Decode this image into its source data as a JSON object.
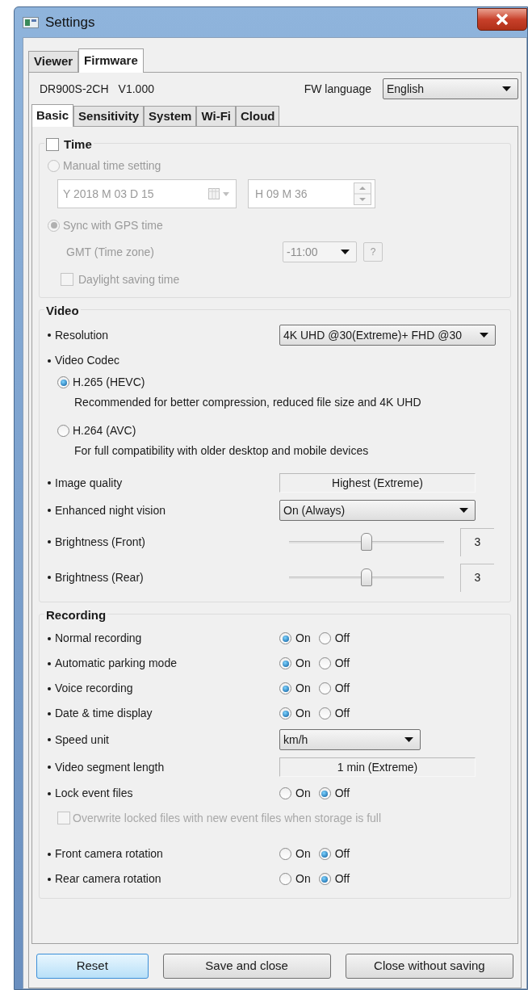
{
  "window": {
    "title": "Settings"
  },
  "top_tabs": [
    {
      "label": "Viewer",
      "selected": false
    },
    {
      "label": "Firmware",
      "selected": true
    }
  ],
  "firmware": {
    "model": "DR900S-2CH",
    "version": "V1.000",
    "language_label": "FW language",
    "language": "English"
  },
  "sub_tabs": [
    {
      "label": "Basic",
      "selected": true
    },
    {
      "label": "Sensitivity",
      "selected": false
    },
    {
      "label": "System",
      "selected": false
    },
    {
      "label": "Wi-Fi",
      "selected": false
    },
    {
      "label": "Cloud",
      "selected": false
    }
  ],
  "time": {
    "title": "Time",
    "checked": false,
    "manual": {
      "label": "Manual time setting",
      "selected": false
    },
    "date": "Y 2018 M 03 D 15",
    "clock": "H 09 M 36",
    "gps": {
      "label": "Sync with GPS time",
      "selected": true
    },
    "timezone_label": "GMT (Time zone)",
    "timezone": "-11:00",
    "help": "?",
    "dst": {
      "label": "Daylight saving time",
      "checked": false
    }
  },
  "video": {
    "title": "Video",
    "rows": [
      {
        "kind": "select",
        "label": "Resolution",
        "value": "4K UHD @30(Extreme)+ FHD @30",
        "wide": true
      },
      {
        "kind": "codec",
        "label": "Video Codec",
        "options": [
          {
            "label": "H.265 (HEVC)",
            "description": "Recommended for better compression, reduced file size and 4K UHD",
            "selected": true
          },
          {
            "label": "H.264 (AVC)",
            "description": "For full compatibility with older desktop and mobile devices",
            "selected": false
          }
        ]
      },
      {
        "kind": "display",
        "label": "Image quality",
        "value": "Highest (Extreme)"
      },
      {
        "kind": "select",
        "label": "Enhanced night vision",
        "value": "On (Always)",
        "wide": false
      },
      {
        "kind": "slider",
        "label": "Brightness (Front)",
        "level": 0.5,
        "reading": "3"
      },
      {
        "kind": "slider",
        "label": "Brightness (Rear)",
        "level": 0.5,
        "reading": "3"
      }
    ]
  },
  "recording": {
    "title": "Recording",
    "rows": [
      {
        "kind": "onoff",
        "label": "Normal recording",
        "options": [
          {
            "label": "On",
            "selected": true
          },
          {
            "label": "Off",
            "selected": false
          }
        ]
      },
      {
        "kind": "onoff",
        "label": "Automatic parking mode",
        "options": [
          {
            "label": "On",
            "selected": true
          },
          {
            "label": "Off",
            "selected": false
          }
        ]
      },
      {
        "kind": "onoff",
        "label": "Voice recording",
        "options": [
          {
            "label": "On",
            "selected": true
          },
          {
            "label": "Off",
            "selected": false
          }
        ]
      },
      {
        "kind": "onoff",
        "label": "Date & time display",
        "options": [
          {
            "label": "On",
            "selected": true
          },
          {
            "label": "Off",
            "selected": false
          }
        ]
      },
      {
        "kind": "select",
        "label": "Speed unit",
        "value": "km/h",
        "wide": false
      },
      {
        "kind": "display",
        "label": "Video segment length",
        "value": "1 min (Extreme)"
      },
      {
        "kind": "onoff",
        "label": "Lock event files",
        "options": [
          {
            "label": "On",
            "selected": false
          },
          {
            "label": "Off",
            "selected": true
          }
        ]
      },
      {
        "kind": "checkbox",
        "label": "Overwrite locked files with new event files when storage is full",
        "checked": false,
        "disabled": true
      },
      {
        "kind": "onoff",
        "label": "Front camera rotation",
        "options": [
          {
            "label": "On",
            "selected": false
          },
          {
            "label": "Off",
            "selected": true
          }
        ]
      },
      {
        "kind": "onoff",
        "label": "Rear camera rotation",
        "options": [
          {
            "label": "On",
            "selected": false
          },
          {
            "label": "Off",
            "selected": true
          }
        ]
      }
    ]
  },
  "buttons": [
    {
      "label": "Reset",
      "focused": true
    },
    {
      "label": "Save and close",
      "focused": false
    },
    {
      "label": "Close without saving",
      "focused": false
    }
  ]
}
